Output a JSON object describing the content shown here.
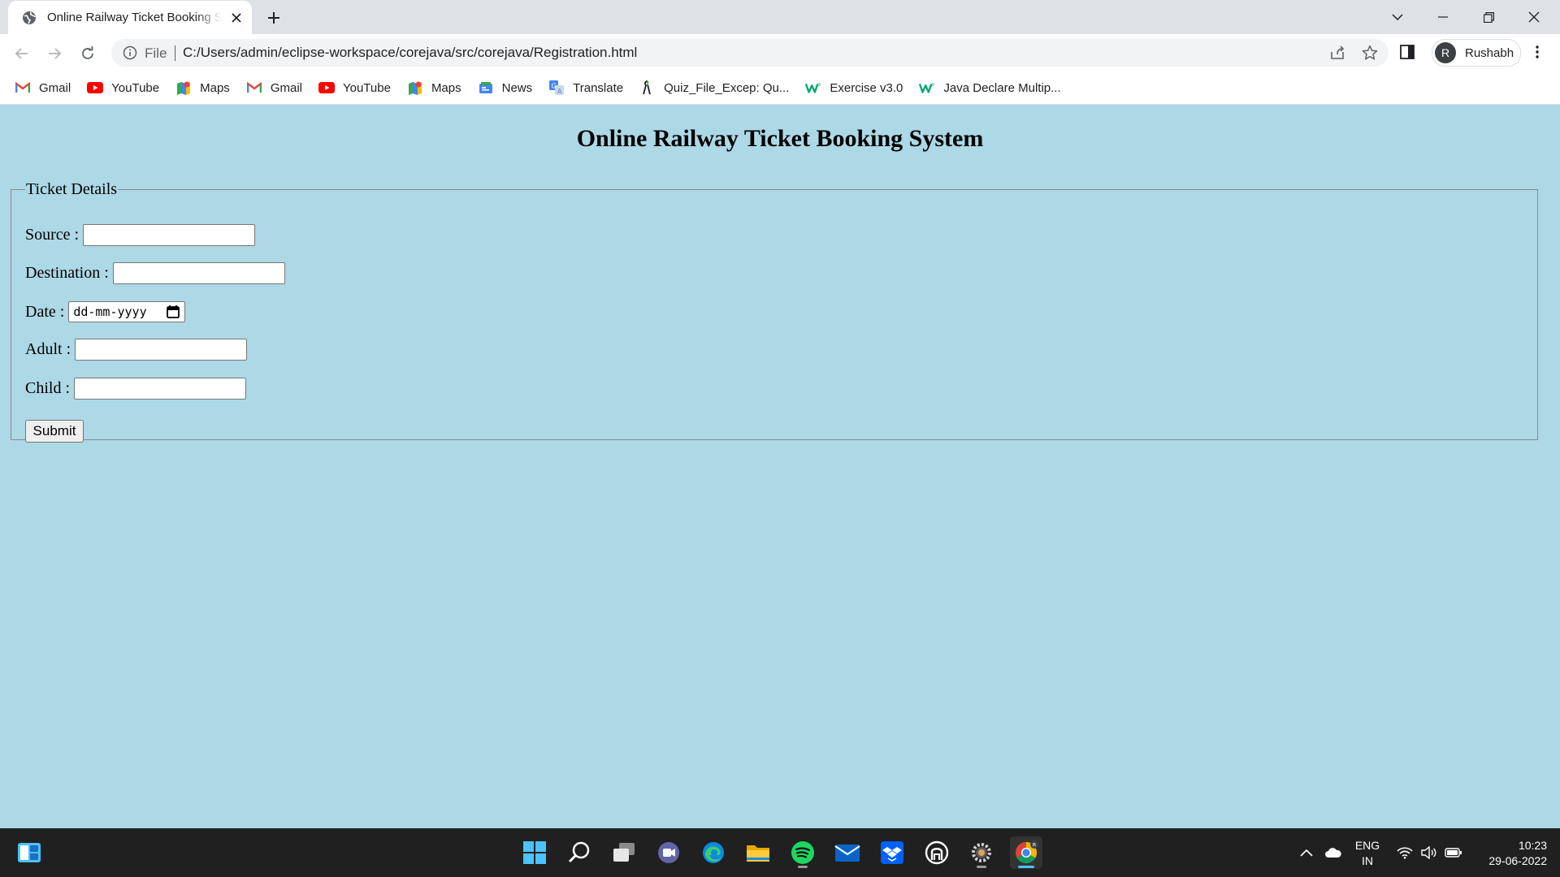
{
  "browser": {
    "tab_title": "Online Railway Ticket Booking System",
    "address": {
      "scheme_label": "File",
      "url": "C:/Users/admin/eclipse-workspace/corejava/src/corejava/Registration.html"
    },
    "profile": {
      "initial": "R",
      "name": "Rushabh"
    }
  },
  "bookmarks": [
    {
      "label": "Gmail",
      "icon": "gmail-icon"
    },
    {
      "label": "YouTube",
      "icon": "youtube-icon"
    },
    {
      "label": "Maps",
      "icon": "maps-icon"
    },
    {
      "label": "Gmail",
      "icon": "gmail-icon"
    },
    {
      "label": "YouTube",
      "icon": "youtube-icon"
    },
    {
      "label": "Maps",
      "icon": "maps-icon"
    },
    {
      "label": "News",
      "icon": "news-icon"
    },
    {
      "label": "Translate",
      "icon": "translate-icon"
    },
    {
      "label": "Quiz_File_Excep: Qu...",
      "icon": "quiz-icon"
    },
    {
      "label": "Exercise v3.0",
      "icon": "w3schools-icon"
    },
    {
      "label": "Java Declare Multip...",
      "icon": "w3schools-icon"
    }
  ],
  "page": {
    "heading": "Online Railway Ticket Booking System",
    "background": "#add8e6",
    "fieldset_legend": "Ticket Details",
    "fields": {
      "source": {
        "label": "Source :",
        "value": ""
      },
      "destination": {
        "label": "Destination :",
        "value": ""
      },
      "date": {
        "label": "Date :",
        "placeholder": "dd-mm-yyyy"
      },
      "adult": {
        "label": "Adult :",
        "value": ""
      },
      "child": {
        "label": "Child :",
        "value": ""
      }
    },
    "submit_label": "Submit"
  },
  "taskbar": {
    "apps": [
      "start-icon",
      "search-icon",
      "task-view-icon",
      "teams-chat-icon",
      "edge-icon",
      "file-explorer-icon",
      "spotify-icon",
      "mail-icon",
      "dropbox-icon",
      "app-icon",
      "settings-icon",
      "chrome-icon"
    ],
    "language": {
      "line1": "ENG",
      "line2": "IN"
    },
    "time": "10:23",
    "date": "29-06-2022"
  }
}
